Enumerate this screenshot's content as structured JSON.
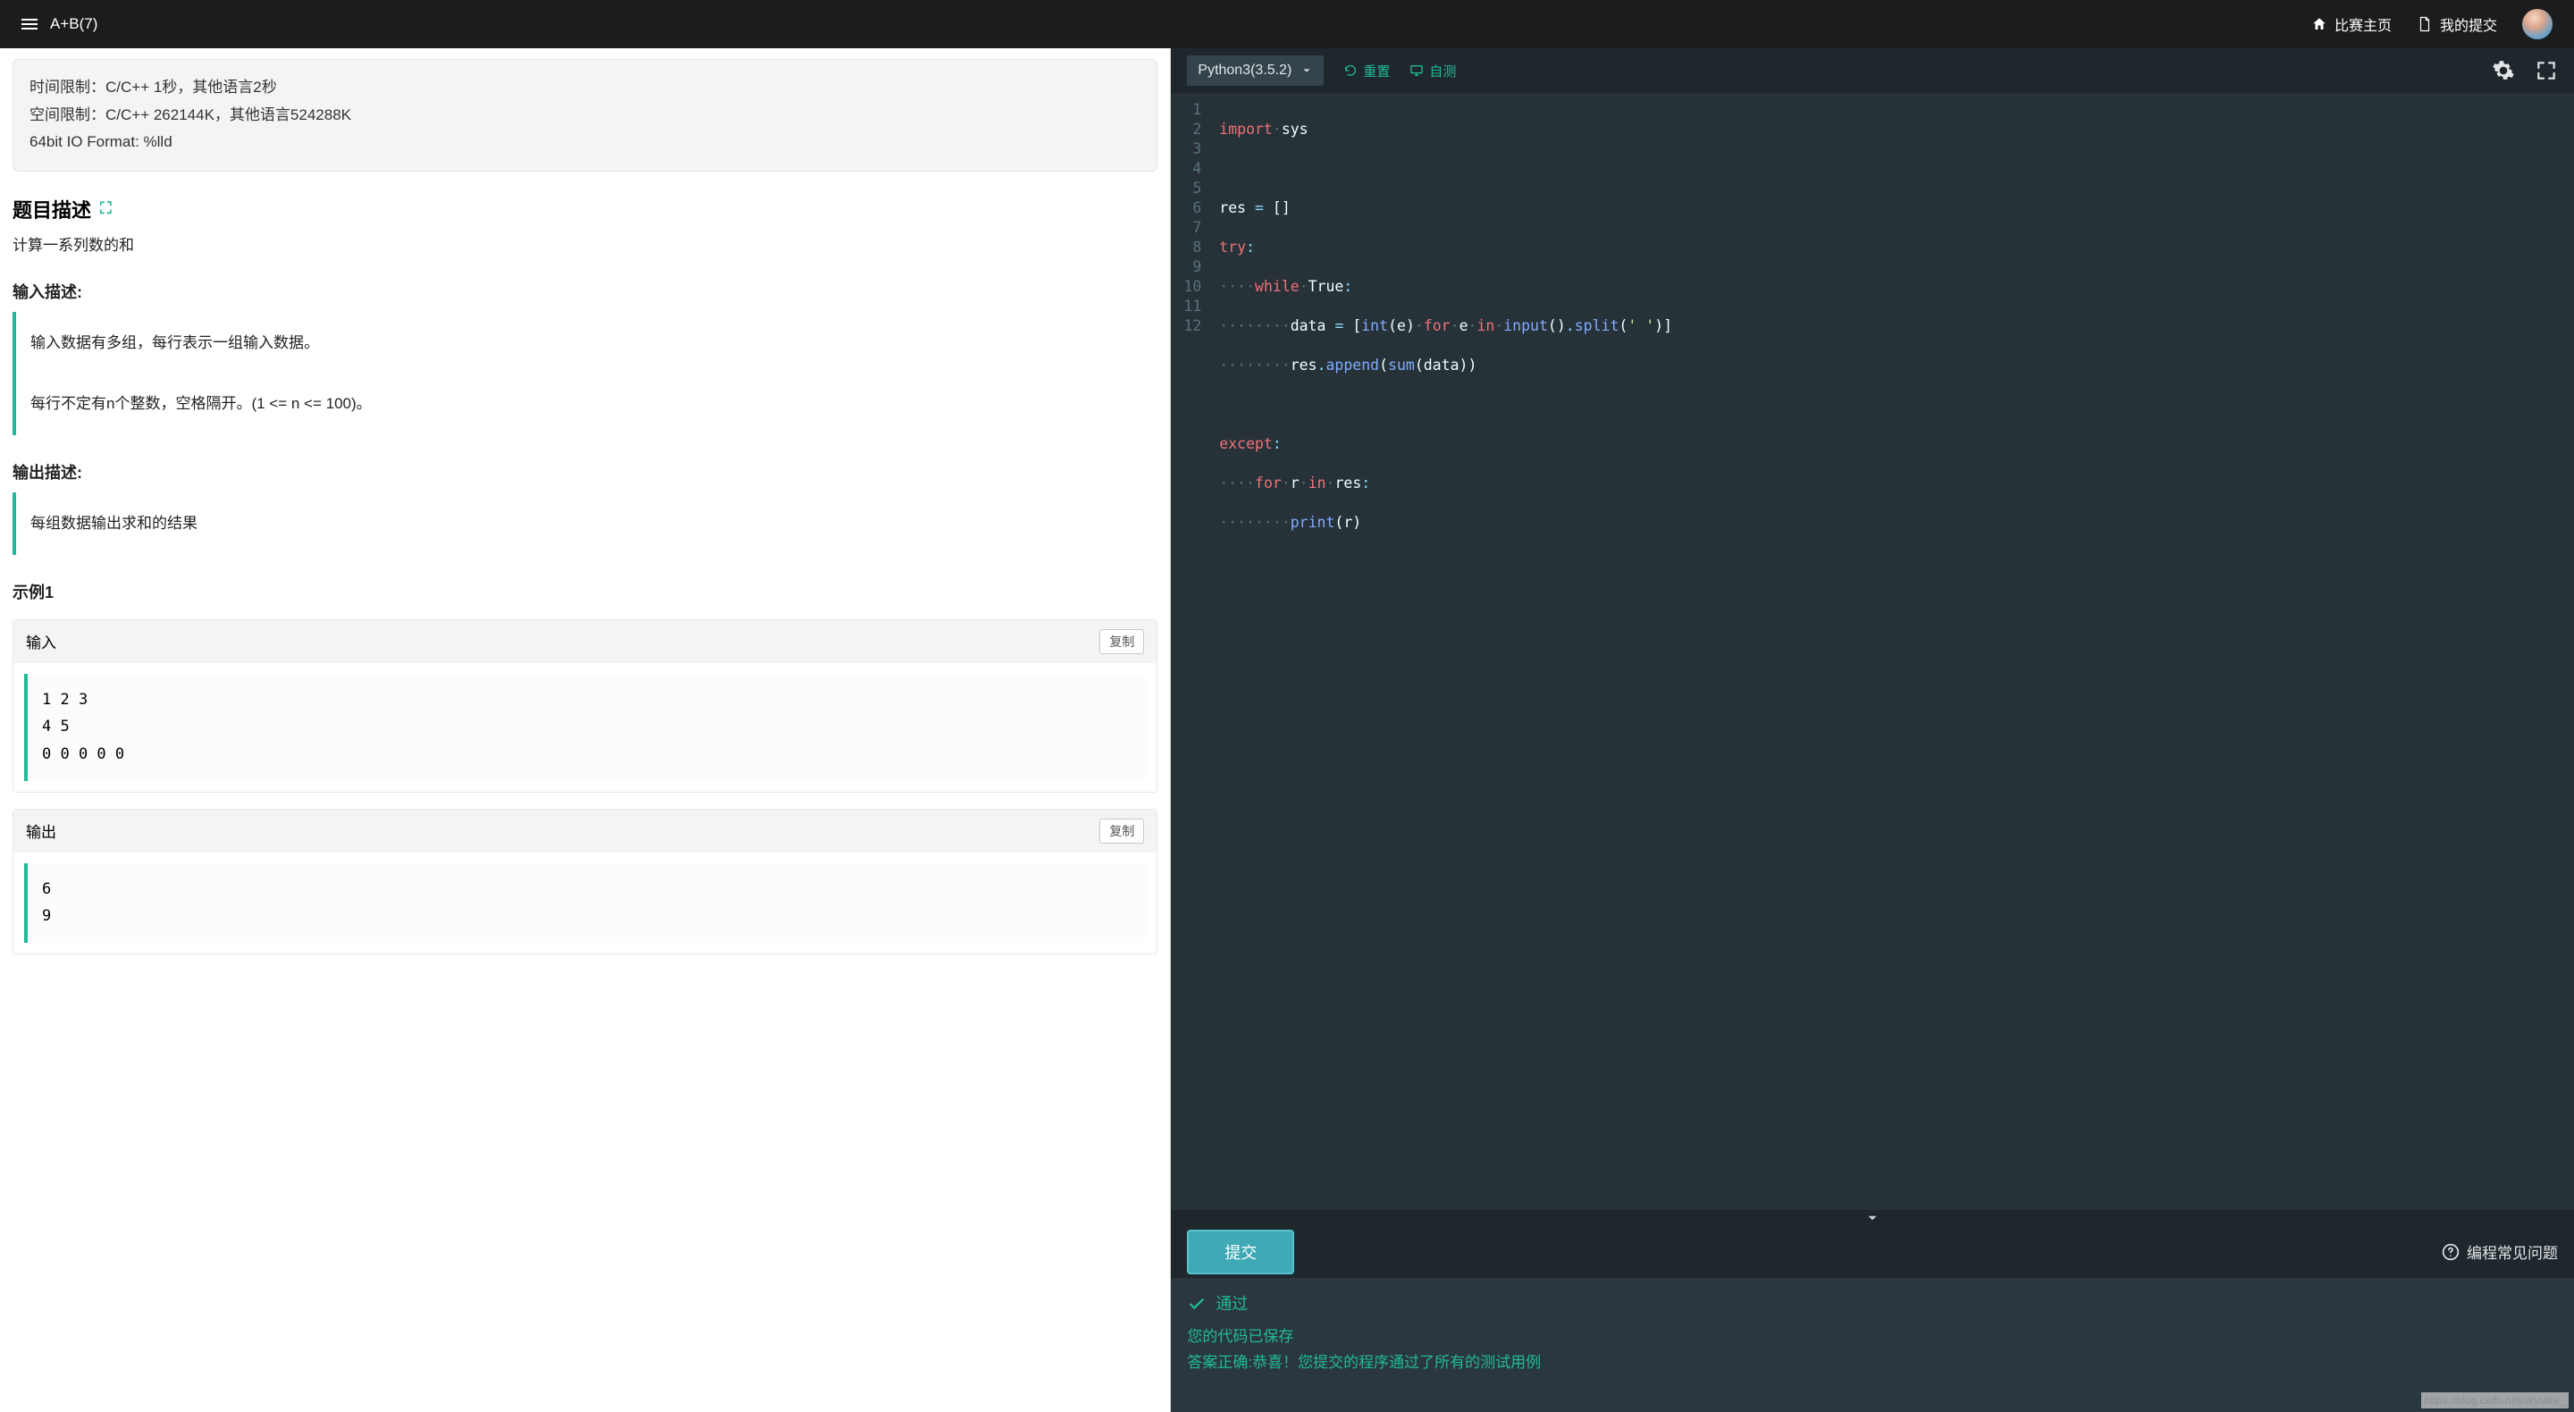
{
  "topbar": {
    "title": "A+B(7)",
    "home_label": "比赛主页",
    "submissions_label": "我的提交"
  },
  "limits": {
    "time": "时间限制：C/C++ 1秒，其他语言2秒",
    "memory": "空间限制：C/C++ 262144K，其他语言524288K",
    "io": "64bit IO Format: %lld"
  },
  "sections": {
    "desc_title": "题目描述",
    "desc_body": "计算一系列数的和",
    "input_title": "输入描述:",
    "input_body": "输入数据有多组，每行表示一组输入数据。\n\n每行不定有n个整数，空格隔开。(1 <= n <= 100)。",
    "output_title": "输出描述:",
    "output_body": "每组数据输出求和的结果",
    "example_title": "示例1",
    "example_input_label": "输入",
    "example_output_label": "输出",
    "copy_label": "复制",
    "example_input": "1 2 3\n4 5\n0 0 0 0 0",
    "example_output": "6\n9"
  },
  "editor": {
    "language": "Python3(3.5.2)",
    "reset_label": "重置",
    "selftest_label": "自测"
  },
  "code": {
    "lines": 12
  },
  "submit": {
    "button_label": "提交",
    "faq_label": "编程常见问题"
  },
  "result": {
    "status": "通过",
    "saved": "您的代码已保存",
    "message": "答案正确:恭喜！您提交的程序通过了所有的测试用例"
  },
  "watermark": "https://blog.csdn.net/skylake_"
}
